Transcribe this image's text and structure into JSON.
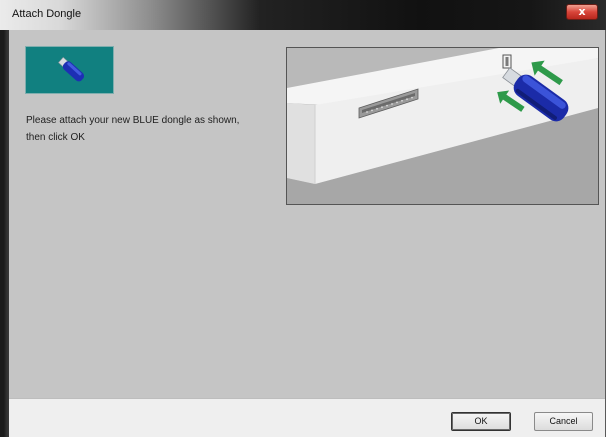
{
  "window": {
    "title": "Attach Dongle",
    "close_glyph": "x"
  },
  "main": {
    "message_line1": "Please attach your new BLUE dongle as shown,",
    "message_line2": "then click OK",
    "icon": "blue-dongle-icon",
    "illustration": "dongle-insertion-illustration"
  },
  "buttons": {
    "ok_label": "OK",
    "cancel_label": "Cancel"
  },
  "colors": {
    "icon_background": "#118080",
    "dongle_blue": "#1a2fb0",
    "arrow_green": "#2e9a4a"
  }
}
